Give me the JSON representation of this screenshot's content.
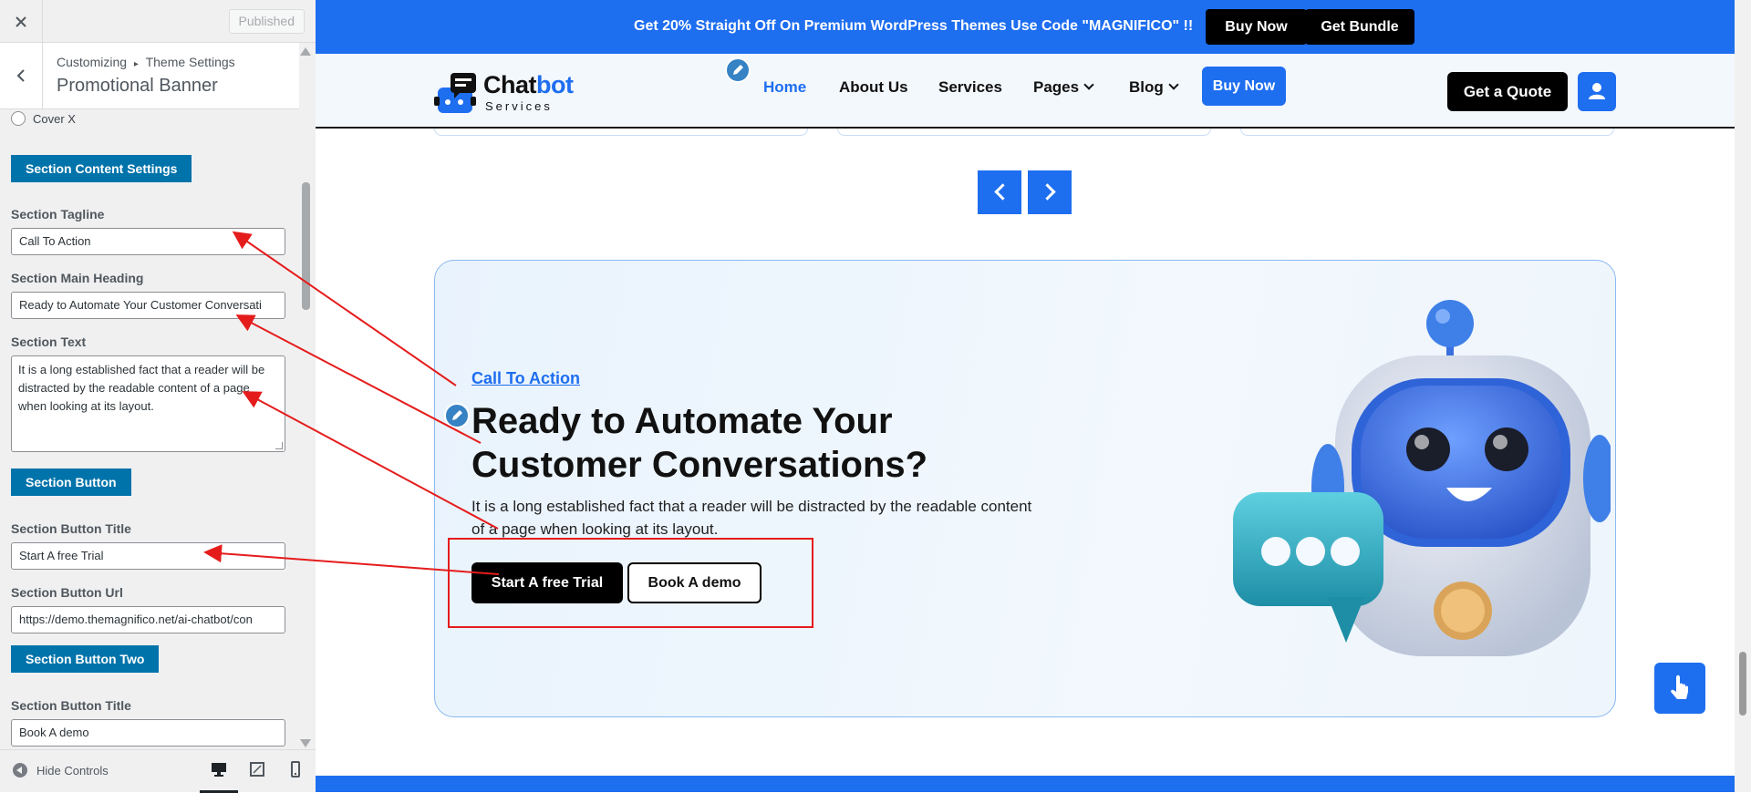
{
  "customizer": {
    "close_icon": "close-icon",
    "published_label": "Published",
    "breadcrumb_root": "Customizing",
    "breadcrumb_sep": "▸",
    "breadcrumb_section": "Theme Settings",
    "panel_title": "Promotional Banner",
    "radio_cover_x": "Cover X",
    "section_content_settings": "Section Content Settings",
    "tagline_label": "Section Tagline",
    "tagline_value": "Call To Action",
    "heading_label": "Section Main Heading",
    "heading_value": "Ready to Automate Your Customer Conversati",
    "text_label": "Section Text",
    "text_value": "It is a long established fact that a reader will be distracted by the readable content of a page when looking at its layout.",
    "section_button": "Section Button",
    "button_title_label": "Section Button Title",
    "button_title_value": "Start A free Trial",
    "button_url_label": "Section Button Url",
    "button_url_value": "https://demo.themagnifico.net/ai-chatbot/con",
    "section_button_two": "Section Button Two",
    "button_two_title_label": "Section Button Title",
    "button_two_title_value": "Book A demo",
    "hide_controls": "Hide Controls"
  },
  "promo_bar": {
    "text": "Get 20% Straight Off On Premium WordPress Themes Use Code \"MAGNIFICO\" !!",
    "buy_now": "Buy Now",
    "get_bundle": "Get Bundle"
  },
  "logo": {
    "word_a": "Chat",
    "word_b": "bot",
    "sub": "Services"
  },
  "nav": {
    "items": [
      "Home",
      "About Us",
      "Services",
      "Pages",
      "Blog"
    ],
    "buy_now": "Buy Now",
    "get_quote": "Get a Quote"
  },
  "cta": {
    "tagline": "Call To Action",
    "heading": "Ready to Automate Your Customer Conversations?",
    "text": "It is a long established fact that a reader will be distracted by the readable content of a page when looking at its layout.",
    "button_primary": "Start A free Trial",
    "button_secondary": "Book A demo"
  },
  "colors": {
    "brand_blue": "#1e6ef0",
    "wp_blue": "#0073aa",
    "annotation_red": "#e51c1c"
  }
}
